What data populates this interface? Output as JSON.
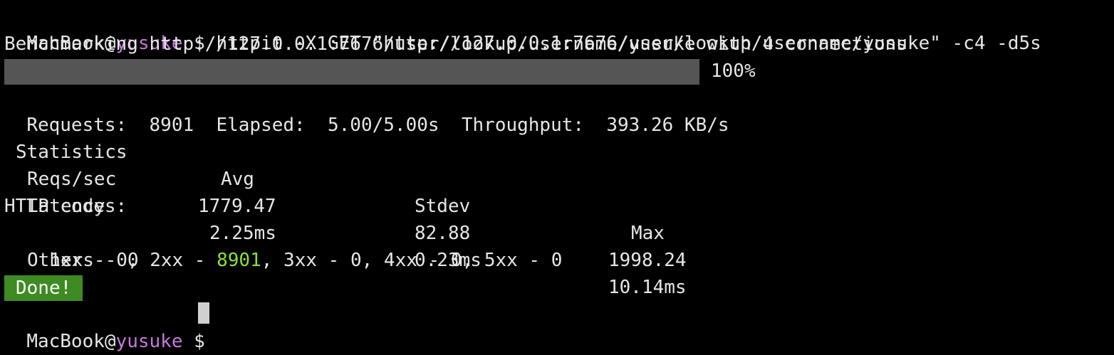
{
  "theme": {
    "background": "#000000",
    "text": "#e6e6e6",
    "username_color": "#c678dd",
    "success_color": "#8ae234",
    "progress_fill": "#555555",
    "done_badge_bg": "#3d8b22"
  },
  "prompt": {
    "host": "MacBook@",
    "user": "yusuke",
    "symbol": " $ ",
    "command": "httpit -X GET \"http://127.0.0.1:7676/user/lookup/username/yusuke\" -c4 -d5s"
  },
  "benchmark_line": "Benchmarking http://127.0.0.1:7676/user/lookup/username/yusuke with 4 connections",
  "progress": {
    "value_percent": 100,
    "label": "100%"
  },
  "summary": {
    "requests_label": "Requests:",
    "requests_value": "8901",
    "elapsed_label": "Elapsed:",
    "elapsed_value": "5.00/5.00s",
    "throughput_label": "Throughput:",
    "throughput_value": "393.26 KB/s"
  },
  "stats": {
    "headers": [
      "Statistics",
      "Avg",
      "Stdev",
      "Max"
    ],
    "rows": [
      {
        "name": "Reqs/sec",
        "avg": "1779.47",
        "stdev": "82.88",
        "max": "1998.24"
      },
      {
        "name": "Latency",
        "avg": "2.25ms",
        "stdev": "0.23ms",
        "max": "10.14ms"
      }
    ]
  },
  "http_codes": {
    "label": "HTTP codes:",
    "line_prefix": "1xx - 0, 2xx - ",
    "count_2xx": "8901",
    "line_suffix": ", 3xx - 0, 4xx - 0, 5xx - 0",
    "others": "Others - 0"
  },
  "done_label": "Done!",
  "next_prompt": {
    "host": "MacBook@",
    "user": "yusuke",
    "symbol": " $ "
  }
}
